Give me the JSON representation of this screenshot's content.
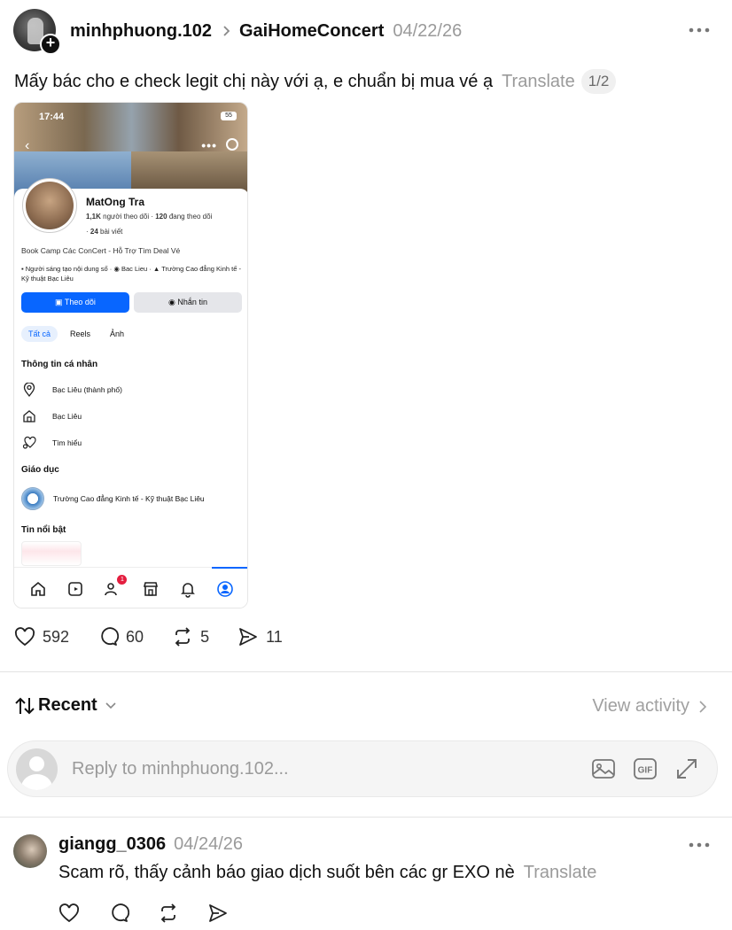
{
  "post": {
    "username": "minhphuong.102",
    "community": "GaiHomeConcert",
    "date": "04/22/26",
    "text": "Mấy bác cho e check legit chị này với ạ, e chuẩn bị mua vé ạ",
    "translate_label": "Translate",
    "pager": "1/2",
    "stats": {
      "likes": "592",
      "comments": "60",
      "reposts": "5",
      "shares": "11"
    }
  },
  "embedded_profile": {
    "status_time": "17:44",
    "battery": "55",
    "name": "MatOng Tra",
    "followers_count": "1,1K",
    "followers_label": "người theo dõi",
    "following_count": "120",
    "following_label": "đang theo dõi",
    "posts_count": "24",
    "posts_label": "bài viết",
    "bio": "Book Camp Các ConCert - Hỗ Trợ Tìm Deal Vé",
    "meta_creator": "Người sáng tạo nội dung số",
    "meta_location": "Bac Lieu",
    "meta_school": "Trường Cao đẳng Kinh tế - Kỹ thuật Bạc Liêu",
    "follow_button": "Theo dõi",
    "message_button": "Nhắn tin",
    "tabs": [
      "Tất cả",
      "Reels",
      "Ảnh"
    ],
    "personal_info_title": "Thông tin cá nhân",
    "info_city": "Bạc Liêu (thành phố)",
    "info_home": "Bạc Liêu",
    "info_relationship": "Tìm hiểu",
    "education_title": "Giáo dục",
    "education_school": "Trường Cao đẳng Kinh tế - Kỹ thuật Bạc Liêu",
    "highlights_title": "Tin nổi bật",
    "friends_badge": "1"
  },
  "sort": {
    "label": "Recent",
    "view_activity": "View activity"
  },
  "reply": {
    "placeholder": "Reply to minhphuong.102..."
  },
  "comment": {
    "username": "giangg_0306",
    "date": "04/24/26",
    "text": "Scam rõ, thấy cảnh báo giao dịch suốt bên các gr EXO nè",
    "translate_label": "Translate"
  },
  "colors": {
    "accent_blue": "#0866ff",
    "muted": "#9a9a9a",
    "notification_red": "#e41e3f"
  }
}
